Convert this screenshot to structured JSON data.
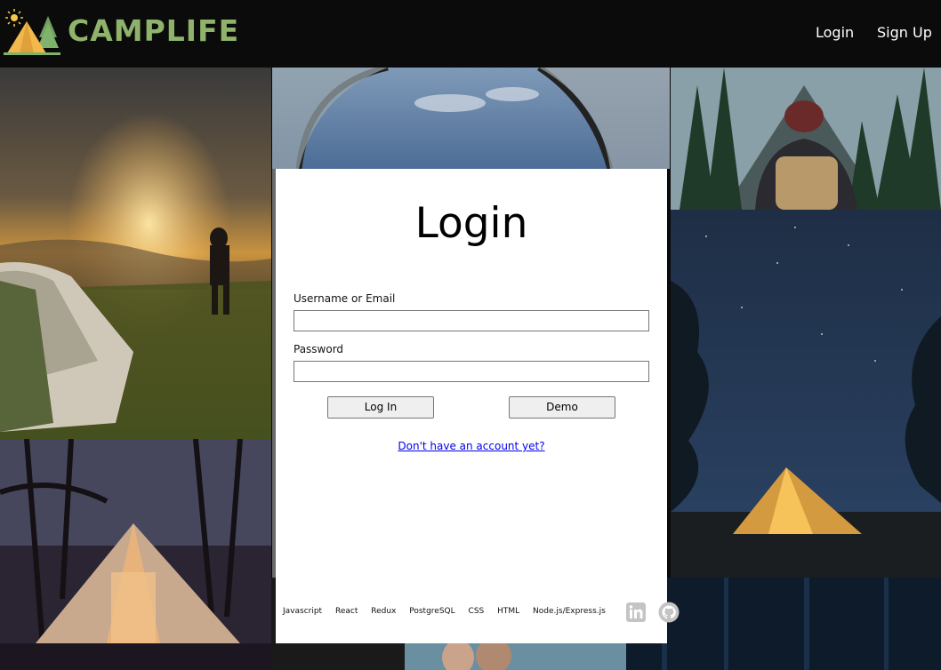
{
  "header": {
    "brand": "CAMPLIFE",
    "nav": {
      "login": "Login",
      "signup": "Sign Up"
    }
  },
  "login_form": {
    "title": "Login",
    "username_label": "Username or Email",
    "username_value": "",
    "password_label": "Password",
    "password_value": "",
    "login_button": "Log In",
    "demo_button": "Demo",
    "signup_link": "Don't have an account yet?"
  },
  "footer": {
    "technologies": [
      "Javascript",
      "React",
      "Redux",
      "PostgreSQL",
      "CSS",
      "HTML",
      "Node.js/Express.js"
    ],
    "icons": [
      "linkedin-icon",
      "github-icon"
    ]
  },
  "colors": {
    "brand_green": "#8fb36b",
    "header_bg": "#0b0b0b",
    "panel_bg": "#ffffff",
    "link_blue": "#0000ee"
  }
}
